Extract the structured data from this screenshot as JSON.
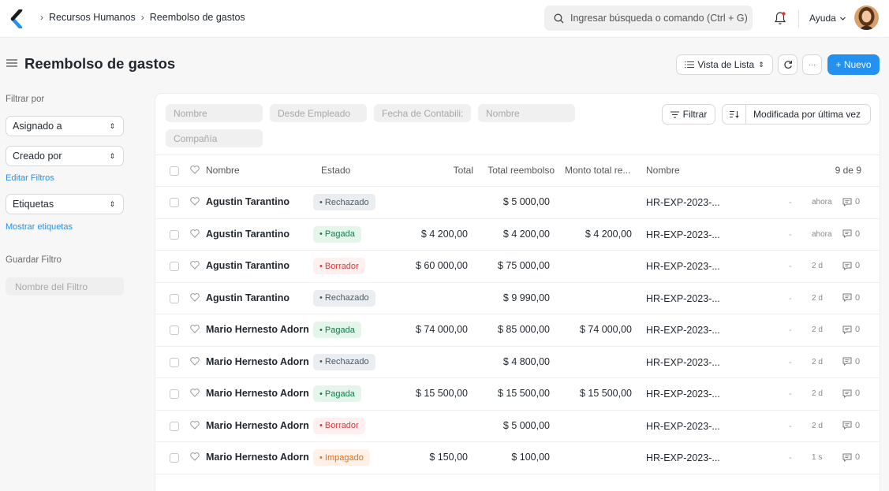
{
  "breadcrumbs": [
    "Recursos Humanos",
    "Reembolso de gastos"
  ],
  "search": {
    "placeholder": "Ingresar búsqueda o comando (Ctrl + G)"
  },
  "help_label": "Ayuda",
  "page": {
    "title": "Reembolso de gastos"
  },
  "toolbar": {
    "view_label": "Vista de Lista",
    "new_label": "+ Nuevo",
    "more_label": "···"
  },
  "sidebar": {
    "filter_by": "Filtrar por",
    "assigned_to": "Asignado a",
    "created_by": "Creado por",
    "edit_filters": "Editar Filtros",
    "tags": "Etiquetas",
    "show_tags": "Mostrar etiquetas",
    "save_filter": "Guardar Filtro",
    "filter_name_placeholder": "Nombre del Filtro"
  },
  "filters": {
    "nombre": "Nombre",
    "desde_empleado": "Desde Empleado",
    "fecha": "Fecha de Contabili:",
    "nombre2": "Nombre",
    "compania": "Compañía",
    "filter_button": "Filtrar",
    "sort_label": "Modificada por última vez"
  },
  "table": {
    "headers": {
      "nombre": "Nombre",
      "estado": "Estado",
      "total": "Total",
      "total_reembolso": "Total reembolso",
      "monto_total": "Monto total re...",
      "nombre2": "Nombre",
      "count": "9 de 9"
    },
    "rows": [
      {
        "name": "Agustin Tarantino",
        "status": "• Rechazado",
        "total": "",
        "reembolso": "$ 5 000,00",
        "monto": "",
        "id": "HR-EXP-2023-...",
        "dash": "-",
        "time": "ahora",
        "comments": "0"
      },
      {
        "name": "Agustin Tarantino",
        "status": "• Pagada",
        "total": "$ 4 200,00",
        "reembolso": "$ 4 200,00",
        "monto": "$ 4 200,00",
        "id": "HR-EXP-2023-...",
        "dash": "-",
        "time": "ahora",
        "comments": "0"
      },
      {
        "name": "Agustin Tarantino",
        "status": "• Borrador",
        "total": "$ 60 000,00",
        "reembolso": "$ 75 000,00",
        "monto": "",
        "id": "HR-EXP-2023-...",
        "dash": "-",
        "time": "2 d",
        "comments": "0"
      },
      {
        "name": "Agustin Tarantino",
        "status": "• Rechazado",
        "total": "",
        "reembolso": "$ 9 990,00",
        "monto": "",
        "id": "HR-EXP-2023-...",
        "dash": "-",
        "time": "2 d",
        "comments": "0"
      },
      {
        "name": "Mario Hernesto Adorn",
        "status": "• Pagada",
        "total": "$ 74 000,00",
        "reembolso": "$ 85 000,00",
        "monto": "$ 74 000,00",
        "id": "HR-EXP-2023-...",
        "dash": "-",
        "time": "2 d",
        "comments": "0"
      },
      {
        "name": "Mario Hernesto Adorn",
        "status": "• Rechazado",
        "total": "",
        "reembolso": "$ 4 800,00",
        "monto": "",
        "id": "HR-EXP-2023-...",
        "dash": "-",
        "time": "2 d",
        "comments": "0"
      },
      {
        "name": "Mario Hernesto Adorn",
        "status": "• Pagada",
        "total": "$ 15 500,00",
        "reembolso": "$ 15 500,00",
        "monto": "$ 15 500,00",
        "id": "HR-EXP-2023-...",
        "dash": "-",
        "time": "2 d",
        "comments": "0"
      },
      {
        "name": "Mario Hernesto Adorn",
        "status": "• Borrador",
        "total": "",
        "reembolso": "$ 5 000,00",
        "monto": "",
        "id": "HR-EXP-2023-...",
        "dash": "-",
        "time": "2 d",
        "comments": "0"
      },
      {
        "name": "Mario Hernesto Adorn",
        "status": "• Impagado",
        "total": "$ 150,00",
        "reembolso": "$ 100,00",
        "monto": "",
        "id": "HR-EXP-2023-...",
        "dash": "-",
        "time": "1 s",
        "comments": "0"
      }
    ]
  },
  "colors": {
    "accent": "#2490ef",
    "status_gray_bg": "#ebeef0",
    "status_gray_fg": "#4c5a67",
    "status_green_bg": "#e4f5e9",
    "status_green_fg": "#16794c",
    "status_red_bg": "#fff0f0",
    "status_red_fg": "#e03636",
    "status_orange_bg": "#fff1e7",
    "status_orange_fg": "#e86c13"
  },
  "icons": [
    "app-logo-icon",
    "search-icon",
    "bell-icon",
    "chevron-down-icon",
    "menu-icon",
    "list-icon",
    "refresh-icon",
    "filter-icon",
    "sort-icon",
    "heart-icon",
    "comment-icon"
  ]
}
